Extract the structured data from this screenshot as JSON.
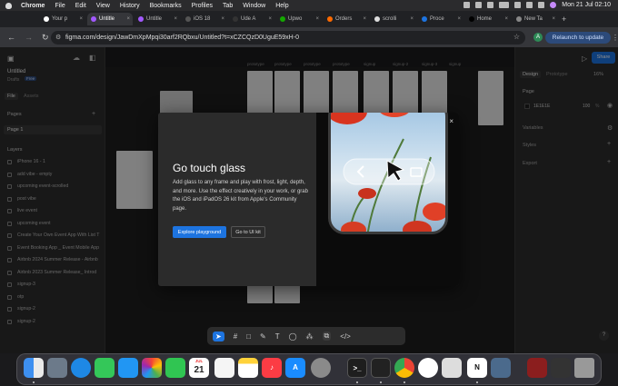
{
  "menubar": {
    "app": "Chrome",
    "items": [
      "File",
      "Edit",
      "View",
      "History",
      "Bookmarks",
      "Profiles",
      "Tab",
      "Window",
      "Help"
    ],
    "clock": "Mon 21 Jul  02:10"
  },
  "tabs": [
    {
      "label": "Your p",
      "color": "#ffffff"
    },
    {
      "label": "Untitle",
      "color": "#a259ff",
      "active": true
    },
    {
      "label": "Untitle",
      "color": "#a259ff"
    },
    {
      "label": "iOS 18",
      "color": "#555555"
    },
    {
      "label": "Ude A",
      "color": "#333333"
    },
    {
      "label": "Upwo",
      "color": "#14a800"
    },
    {
      "label": "Orders",
      "color": "#ff6a00"
    },
    {
      "label": "scrolli",
      "color": "#dddddd"
    },
    {
      "label": "Proce",
      "color": "#1d74e0"
    },
    {
      "label": "Home",
      "color": "#000000"
    },
    {
      "label": "New Ta",
      "color": "#888888"
    }
  ],
  "address": {
    "url": "figma.com/design/JawDmXpMpqi30arf2RQbxu/Untitled?t=xCZCQzD0UguE59xH-0",
    "profile_letter": "A",
    "relaunch_label": "Relaunch to update"
  },
  "figma": {
    "file_title": "Untitled",
    "drafts_label": "Drafts",
    "plan_badge": "Free",
    "tab_file": "File",
    "tab_assets": "Assets",
    "pages_heading": "Pages",
    "current_page": "Page 1",
    "layers_heading": "Layers",
    "layers": [
      "iPhone 16 - 1",
      "add vibe - empty",
      "upcoming event-scrolled",
      "post vibe",
      "live event",
      "upcoming event",
      "Create Your Own Event App With List T",
      "Event Booking App _ Event Mobile App",
      "Airbnb 2024 Summer Release - Airbnb",
      "Airbnb 2023 Summer Release_ Introd",
      "signup-3",
      "otp",
      "signup-2",
      "signup-2"
    ],
    "right": {
      "share_label": "Share",
      "tab_design": "Design",
      "tab_prototype": "Prototype",
      "zoom": "16%",
      "page_heading": "Page",
      "page_color": "1E1E1E",
      "page_opacity": "100",
      "page_opacity_unit": "%",
      "variables": "Variables",
      "styles": "Styles",
      "export": "Export"
    }
  },
  "canvas_labels": [
    "prototype",
    "prototype",
    "prototype",
    "prototype",
    "signup",
    "signup-2",
    "signup-3",
    "signup"
  ],
  "modal": {
    "title": "Go touch glass",
    "body": "Add glass to any frame and play with frost, light, depth, and more. Use the effect creatively in your work, or grab the iOS and iPadOS 26 kit from Apple's Community page.",
    "primary": "Explore playground",
    "secondary": "Go to UI kit",
    "close": "×"
  },
  "toolbar": {
    "tools": [
      "move-tool",
      "frame-tool",
      "shape-tool",
      "pen-tool",
      "text-tool",
      "comment-tool",
      "actions-tool",
      "dev-mode-tool",
      "code-tool"
    ]
  },
  "help": "?",
  "dock": {
    "calendar_month": "JUL",
    "calendar_day": "21"
  }
}
